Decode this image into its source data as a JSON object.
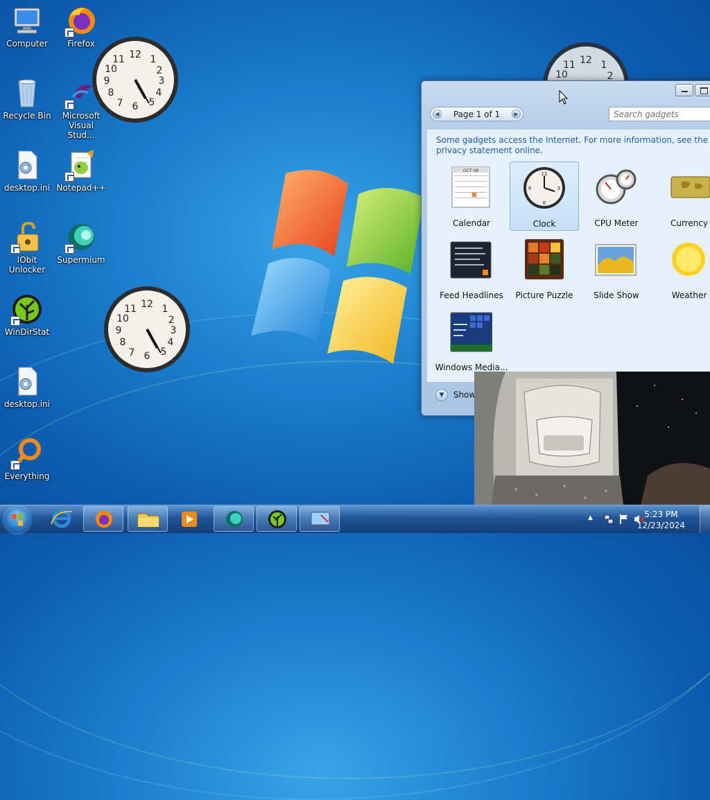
{
  "desktop": {
    "icons": [
      {
        "label": "Computer",
        "shortcut": false,
        "icon": "computer-icon"
      },
      {
        "label": "Firefox",
        "shortcut": true,
        "icon": "firefox-icon"
      },
      {
        "label": "Recycle Bin",
        "shortcut": false,
        "icon": "recycle-bin-icon"
      },
      {
        "label": "Microsoft Visual Stud...",
        "shortcut": true,
        "icon": "visual-studio-icon"
      },
      {
        "label": "desktop.ini",
        "shortcut": false,
        "icon": "settings-file-icon"
      },
      {
        "label": "Notepad++",
        "shortcut": true,
        "icon": "notepad-plus-plus-icon"
      },
      {
        "label": "IObit Unlocker",
        "shortcut": true,
        "icon": "iobit-unlocker-icon"
      },
      {
        "label": "Supermium",
        "shortcut": true,
        "icon": "supermium-icon"
      },
      {
        "label": "WinDirStat",
        "shortcut": true,
        "icon": "windirstat-icon"
      },
      {
        "label": "desktop.ini",
        "shortcut": false,
        "icon": "settings-file-icon"
      },
      {
        "label": "Everything",
        "shortcut": true,
        "icon": "everything-search-icon"
      }
    ]
  },
  "gadget_gallery": {
    "page_label": "Page 1 of 1",
    "search_placeholder": "Search gadgets",
    "info_text": "Some gadgets access the Internet.  For more information, see the privacy statement online.",
    "gadgets": [
      {
        "label": "Calendar",
        "icon": "calendar-icon",
        "selected": false
      },
      {
        "label": "Clock",
        "icon": "clock-icon",
        "selected": true
      },
      {
        "label": "CPU Meter",
        "icon": "cpu-meter-icon",
        "selected": false
      },
      {
        "label": "Currency",
        "icon": "currency-icon",
        "selected": false
      },
      {
        "label": "Feed Headlines",
        "icon": "feed-headlines-icon",
        "selected": false
      },
      {
        "label": "Picture Puzzle",
        "icon": "picture-puzzle-icon",
        "selected": false
      },
      {
        "label": "Slide Show",
        "icon": "slide-show-icon",
        "selected": false
      },
      {
        "label": "Weather",
        "icon": "weather-icon",
        "selected": false
      },
      {
        "label": "Windows Media...",
        "icon": "windows-media-center-icon",
        "selected": false
      }
    ],
    "calendar_month": "OCT 08",
    "show_details_label": "Show"
  },
  "clocks": [
    {
      "hour": 5,
      "minute": 23
    },
    {
      "hour": 5,
      "minute": 23
    },
    {
      "hour": 5,
      "minute": 23
    }
  ],
  "taskbar": {
    "pinned": [
      {
        "name": "internet-explorer-icon"
      },
      {
        "name": "firefox-icon"
      },
      {
        "name": "file-explorer-icon"
      },
      {
        "name": "media-player-icon"
      },
      {
        "name": "supermium-icon"
      },
      {
        "name": "windirstat-icon"
      },
      {
        "name": "gadget-gallery-icon"
      }
    ],
    "time": "5:23 PM",
    "date": "12/23/2024"
  },
  "colors": {
    "accent": "#1e5cad",
    "desktop_blue": "#1c7fcf"
  }
}
